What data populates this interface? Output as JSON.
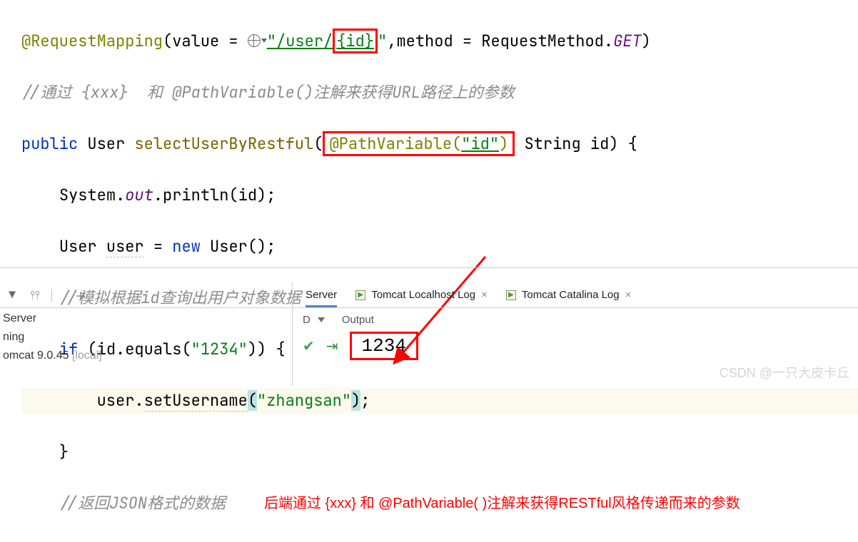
{
  "code": {
    "ann_request_mapping": "@RequestMapping",
    "value_eq": "(value = ",
    "url_prefix": "\"/user/",
    "url_id": "{id}",
    "url_suffix": "\"",
    "method_eq": ",method = RequestMethod.",
    "get": "GET",
    "close_paren": ")",
    "comment1": "//通过 {xxx}  和 @PathVariable()注解来获得URL路径上的参数",
    "public": "public",
    "ret_type": "User",
    "method_name": "selectUserByRestful",
    "open_args": "(",
    "ann_path_var": "@PathVariable(",
    "ann_path_arg": "\"id\"",
    "ann_path_close": ")",
    "param_sig": " String id) {",
    "println_pre": "System.",
    "out": "out",
    "println_call": ".println(id);",
    "user_decl_pre": "User ",
    "user_var": "user",
    "user_decl_mid": " = ",
    "new_kw": "new",
    "user_ctor": " User();",
    "comment2": "//模拟根据id查询出用户对象数据",
    "if_pre": "if",
    "if_cond": " (id.equals(",
    "if_arg": "\"1234\"",
    "if_close": ")) {",
    "set_call_pre": "user.",
    "set_method": "setUsername",
    "set_open": "(",
    "set_arg": "\"zhangsan\"",
    "set_close": ")",
    "semi": ";",
    "brace": "}",
    "comment3": "//返回JSON格式的数据"
  },
  "annotation_text": "后端通过 {xxx} 和 @PathVariable( )注解来获得RESTful风格传递而来的参数",
  "left_panel": {
    "r1": "Server",
    "r2": "ning",
    "r3a": "omcat 9.0.45",
    "r3b": "[local]"
  },
  "tabs": {
    "server": "Server",
    "t1": "Tomcat Localhost Log",
    "t2": "Tomcat Catalina Log"
  },
  "console": {
    "d": "D",
    "output_label": "Output",
    "output_value": "1234"
  },
  "watermark": "CSDN @一只大皮卡丘"
}
